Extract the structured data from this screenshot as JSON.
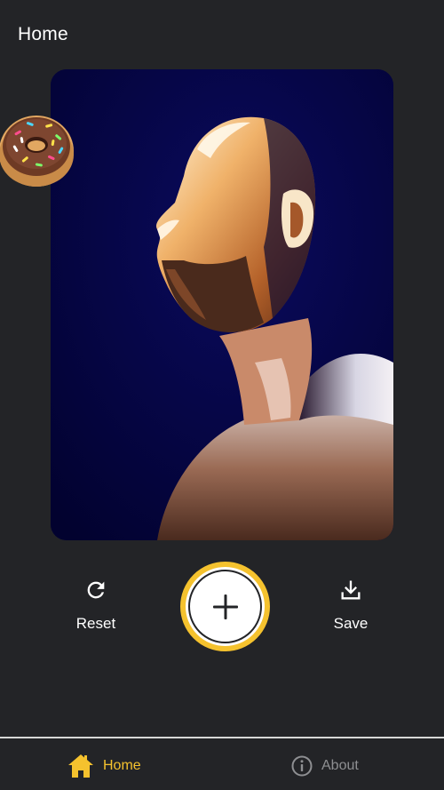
{
  "header": {
    "title": "Home"
  },
  "actions": {
    "reset_label": "Reset",
    "save_label": "Save",
    "add_icon": "plus-icon"
  },
  "nav": {
    "items": [
      {
        "label": "Home",
        "icon": "home-icon",
        "active": true
      },
      {
        "label": "About",
        "icon": "info-icon",
        "active": false
      }
    ]
  },
  "colors": {
    "background": "#232427",
    "accent": "#f5c22e",
    "inactive": "#8e8f92",
    "photo_bg": "#030344"
  }
}
